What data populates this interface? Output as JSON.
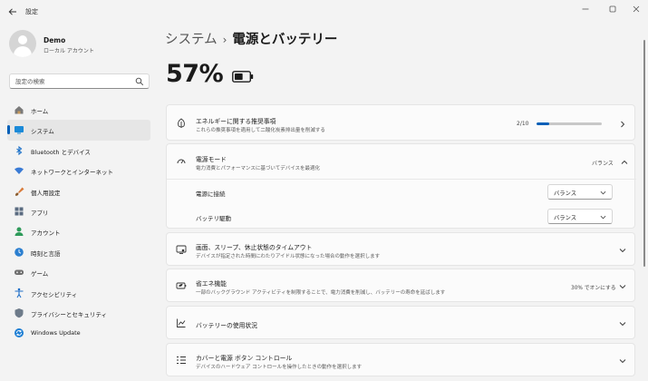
{
  "window": {
    "title": "設定",
    "back_icon": "arrow-left-icon",
    "minimize_icon": "minimize-icon",
    "maximize_icon": "maximize-icon",
    "close_icon": "close-icon"
  },
  "profile": {
    "name": "Demo",
    "account_type": "ローカル アカウント"
  },
  "search": {
    "placeholder": "設定の検索"
  },
  "sidebar": {
    "items": [
      {
        "label": "ホーム",
        "icon": "home-icon",
        "active": false
      },
      {
        "label": "システム",
        "icon": "system-icon",
        "active": true
      },
      {
        "label": "Bluetooth とデバイス",
        "icon": "bluetooth-icon",
        "active": false
      },
      {
        "label": "ネットワークとインターネット",
        "icon": "wifi-icon",
        "active": false
      },
      {
        "label": "個人用設定",
        "icon": "brush-icon",
        "active": false
      },
      {
        "label": "アプリ",
        "icon": "apps-icon",
        "active": false
      },
      {
        "label": "アカウント",
        "icon": "account-icon",
        "active": false
      },
      {
        "label": "時刻と言語",
        "icon": "globe-clock-icon",
        "active": false
      },
      {
        "label": "ゲーム",
        "icon": "gamepad-icon",
        "active": false
      },
      {
        "label": "アクセシビリティ",
        "icon": "accessibility-icon",
        "active": false
      },
      {
        "label": "プライバシーとセキュリティ",
        "icon": "shield-icon",
        "active": false
      },
      {
        "label": "Windows Update",
        "icon": "update-icon",
        "active": false
      }
    ]
  },
  "main": {
    "breadcrumb_root": "システム",
    "breadcrumb_separator": "›",
    "breadcrumb_current": "電源とバッテリー",
    "battery_percent": "57%",
    "battery_level": 0.57,
    "energy": {
      "title": "エネルギーに関する推奨事項",
      "desc": "これらの推奨事項を適用して二酸化炭素排出量を削減する",
      "progress_text": "2/10",
      "progress_value": 0.2
    },
    "power_mode": {
      "title": "電源モード",
      "desc": "電力消費とパフォーマンスに基づいてデバイスを最適化",
      "value": "バランス",
      "plugged_label": "電源に接続",
      "plugged_value": "バランス",
      "battery_label": "バッテリ駆動",
      "battery_value": "バランス"
    },
    "screen_sleep": {
      "title": "画面、スリープ、休止状態のタイムアウト",
      "desc": "デバイスが指定された時間にわたりアイドル状態になった場合の動作を選択します"
    },
    "energy_saver": {
      "title": "省エネ機能",
      "desc": "一部のバックグラウンド アクティビティを制限することで、電力消費を削減し、バッテリーの寿命を延ばします",
      "value": "30% でオンにする"
    },
    "battery_usage": {
      "title": "バッテリーの使用状況"
    },
    "lid_buttons": {
      "title": "カバーと電源 ボタン コントロール",
      "desc": "デバイスのハードウェア コントロールを操作したときの動作を選択します"
    }
  },
  "colors": {
    "accent": "#005fb8",
    "background": "#f3f3f3",
    "card": "#fbfbfb"
  }
}
